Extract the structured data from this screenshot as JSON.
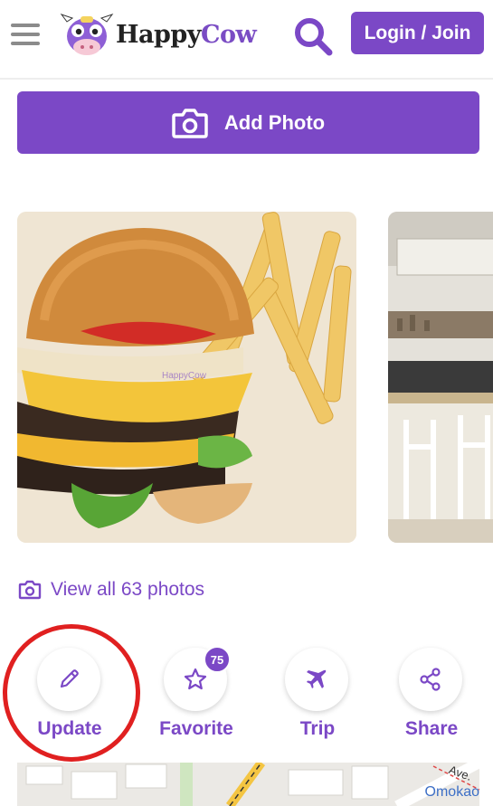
{
  "header": {
    "logo": {
      "word1": "Happy",
      "word2": "Cow"
    },
    "login_label": "Login / Join"
  },
  "add_photo": {
    "label": "Add Photo"
  },
  "photos": {
    "view_all_label": "View all 63 photos"
  },
  "actions": [
    {
      "label": "Update",
      "icon": "pencil-icon"
    },
    {
      "label": "Favorite",
      "icon": "star-icon",
      "badge": "75"
    },
    {
      "label": "Trip",
      "icon": "airplane-icon"
    },
    {
      "label": "Share",
      "icon": "share-icon"
    }
  ],
  "map": {
    "street_label": "Ave.",
    "place_label": "Omokao"
  },
  "colors": {
    "brand": "#7b48c6",
    "highlight": "#e02020"
  }
}
